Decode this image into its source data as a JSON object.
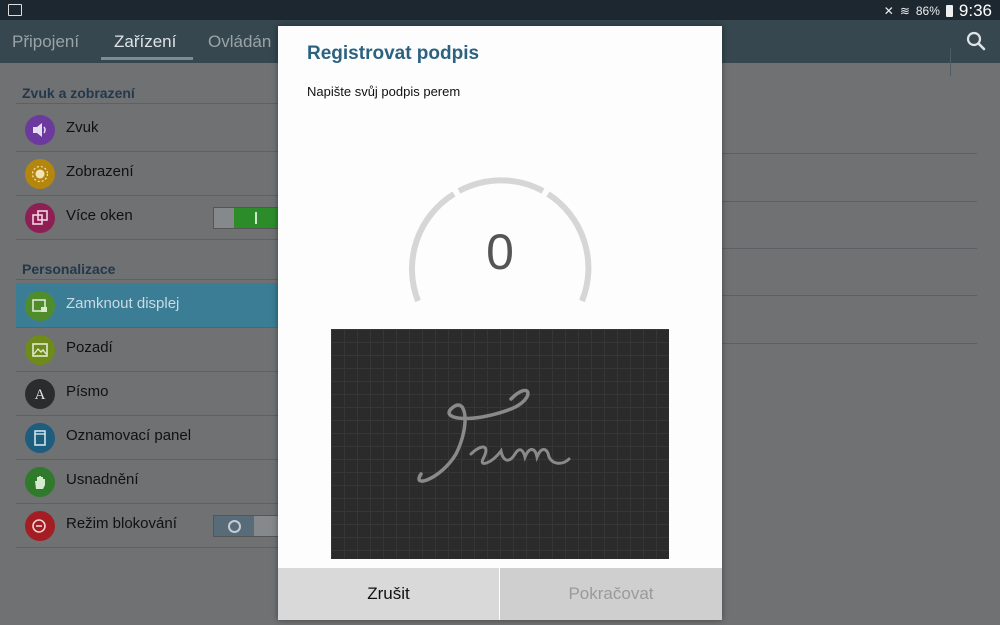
{
  "status": {
    "battery": "86%",
    "time": "9:36"
  },
  "tabs": [
    {
      "label": "Připojení"
    },
    {
      "label": "Zařízení"
    },
    {
      "label": "Ovládán"
    }
  ],
  "sections": {
    "sound": "Zvuk a zobrazení",
    "personal": "Personalizace"
  },
  "items": {
    "zvuk": "Zvuk",
    "zobrazeni": "Zobrazení",
    "vice_oken": "Více oken",
    "zamknout": "Zamknout displej",
    "pozadi": "Pozadí",
    "pismo": "Písmo",
    "oznamovaci": "Oznamovací panel",
    "usnadneni": "Usnadnění",
    "rezim": "Režim blokování"
  },
  "toggles": {
    "vice_oken": "on",
    "rezim_blokovani": "off"
  },
  "dialog": {
    "title": "Registrovat podpis",
    "subtitle": "Napište svůj podpis perem",
    "counter": "0",
    "cancel": "Zrušit",
    "continue": "Pokračovat"
  },
  "colors": {
    "accent": "#2c6280",
    "selected_row": "#3a7d95",
    "toggle_on": "#2c8c2a",
    "topbar": "#36474f"
  }
}
